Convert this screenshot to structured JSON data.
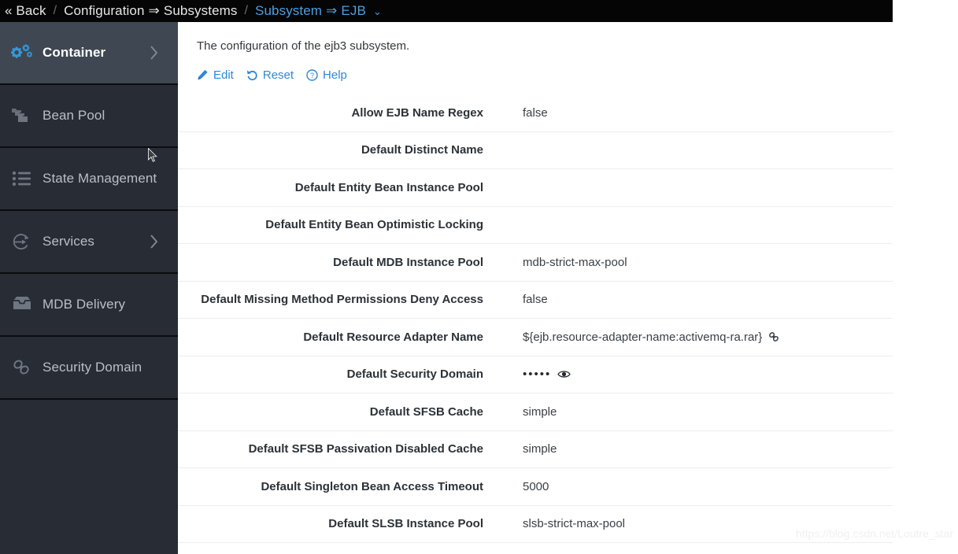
{
  "breadcrumb": {
    "back_label": "« Back",
    "sep": "/",
    "item1_text": "Configuration",
    "item1_arrow": "⇒",
    "item1_target": "Subsystems",
    "item2_text": "Subsystem",
    "item2_arrow": "⇒",
    "item2_target": "EJB",
    "caret": "⌄"
  },
  "sidebar": {
    "items": [
      {
        "label": "Container",
        "icon": "cogs-icon",
        "active": true,
        "has_chevron": true
      },
      {
        "label": "Bean Pool",
        "icon": "folders-icon",
        "active": false,
        "has_chevron": false
      },
      {
        "label": "State Management",
        "icon": "list-icon",
        "active": false,
        "has_chevron": false
      },
      {
        "label": "Services",
        "icon": "exchange-circle-icon",
        "active": false,
        "has_chevron": true
      },
      {
        "label": "MDB Delivery",
        "icon": "inbox-icon",
        "active": false,
        "has_chevron": false
      },
      {
        "label": "Security Domain",
        "icon": "link-chain-icon",
        "active": false,
        "has_chevron": false
      }
    ]
  },
  "main": {
    "description": "The configuration of the ejb3 subsystem.",
    "toolbar": {
      "edit_label": "Edit",
      "reset_label": "Reset",
      "help_label": "Help"
    },
    "attributes": [
      {
        "label": "Allow EJB Name Regex",
        "value": "false",
        "icon": ""
      },
      {
        "label": "Default Distinct Name",
        "value": "",
        "icon": ""
      },
      {
        "label": "Default Entity Bean Instance Pool",
        "value": "",
        "icon": ""
      },
      {
        "label": "Default Entity Bean Optimistic Locking",
        "value": "",
        "icon": ""
      },
      {
        "label": "Default MDB Instance Pool",
        "value": "mdb-strict-max-pool",
        "icon": ""
      },
      {
        "label": "Default Missing Method Permissions Deny Access",
        "value": "false",
        "icon": ""
      },
      {
        "label": "Default Resource Adapter Name",
        "value": "${ejb.resource-adapter-name:activemq-ra.rar}",
        "icon": "link-icon"
      },
      {
        "label": "Default Security Domain",
        "value": "•••••",
        "icon": "eye-icon",
        "masked": true
      },
      {
        "label": "Default SFSB Cache",
        "value": "simple",
        "icon": ""
      },
      {
        "label": "Default SFSB Passivation Disabled Cache",
        "value": "simple",
        "icon": ""
      },
      {
        "label": "Default Singleton Bean Access Timeout",
        "value": "5000",
        "icon": ""
      },
      {
        "label": "Default SLSB Instance Pool",
        "value": "slsb-strict-max-pool",
        "icon": ""
      }
    ]
  },
  "watermark": "https://blog.csdn.net/Loutre_star",
  "colors": {
    "header_bg": "#050505",
    "sidebar_bg": "#272c35",
    "sidebar_active_bg": "#3f4752",
    "accent_blue": "#2f88d4",
    "crumb_link": "#4e9fe0",
    "icon_blue": "#3399dd",
    "icon_gray": "#6f7680",
    "row_border": "#eceef0"
  }
}
